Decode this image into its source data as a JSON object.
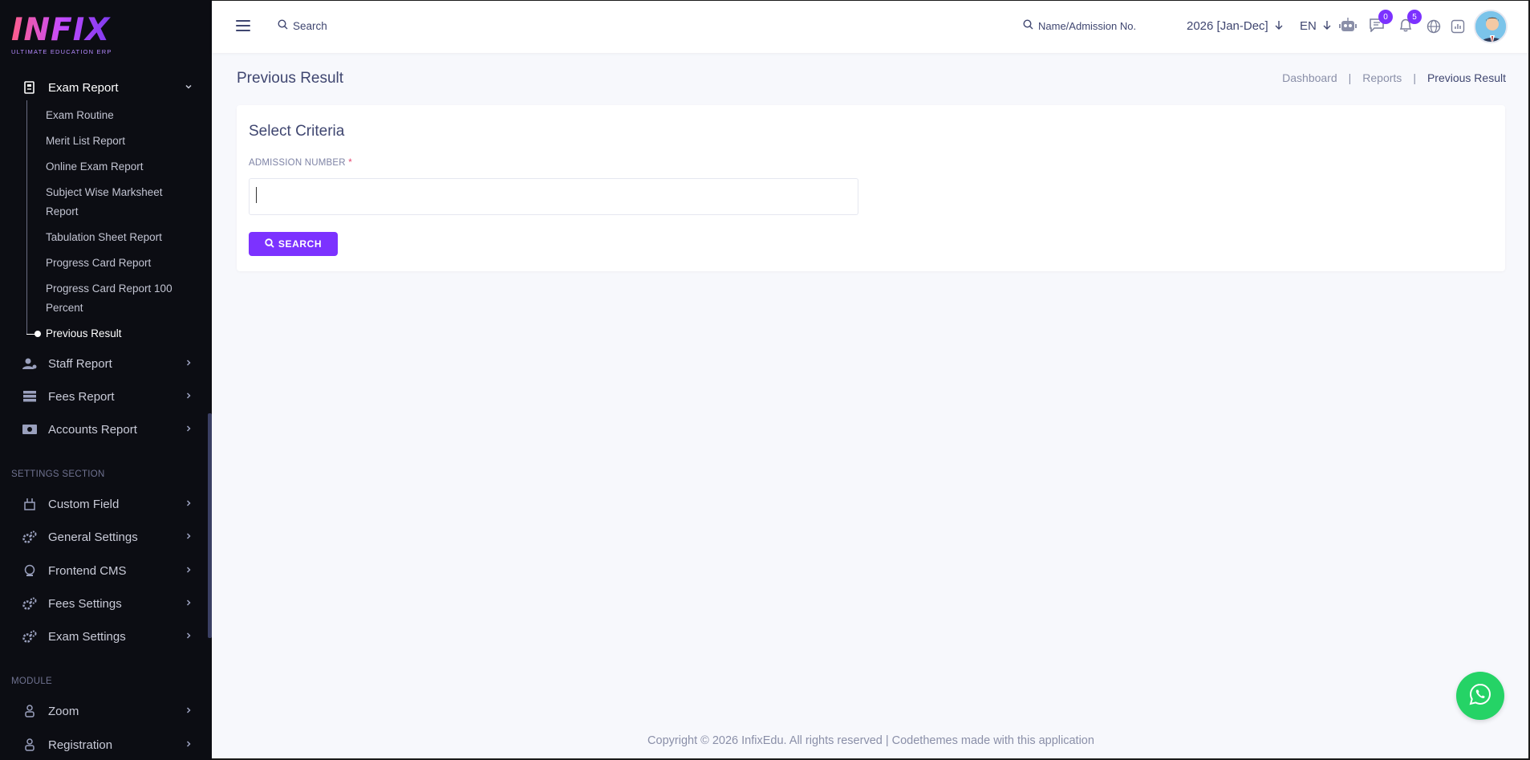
{
  "logo": {
    "title": "INFIX",
    "subtitle": "ULTIMATE EDUCATION ERP"
  },
  "sidebar": {
    "exam_report": {
      "label": "Exam Report",
      "icon": "document-icon"
    },
    "sub_items": [
      "Exam Routine",
      "Merit List Report",
      "Online Exam Report",
      "Subject Wise Marksheet",
      "Report",
      "Tabulation Sheet Report",
      "Progress Card Report",
      "Progress Card Report 100",
      "Percent",
      "Previous Result"
    ],
    "reports": [
      {
        "label": "Staff Report",
        "icon": "user-icon"
      },
      {
        "label": "Fees Report",
        "icon": "stack-icon"
      },
      {
        "label": "Accounts Report",
        "icon": "money-icon"
      }
    ],
    "settings_section": "SETTINGS SECTION",
    "settings": [
      {
        "label": "Custom Field",
        "icon": "form-icon"
      },
      {
        "label": "General Settings",
        "icon": "gears-icon"
      },
      {
        "label": "Frontend CMS",
        "icon": "cms-icon"
      },
      {
        "label": "Fees Settings",
        "icon": "gears-icon"
      },
      {
        "label": "Exam Settings",
        "icon": "gears-icon"
      }
    ],
    "module_section": "MODULE",
    "modules": [
      {
        "label": "Zoom",
        "icon": "person-icon"
      },
      {
        "label": "Registration",
        "icon": "person-icon"
      }
    ]
  },
  "topbar": {
    "search_label": "Search",
    "student_search_label": "Name/Admission No.",
    "session": "2026 [Jan-Dec]",
    "language": "EN",
    "messages_count": "0",
    "notifications_count": "5"
  },
  "page": {
    "title": "Previous Result",
    "breadcrumb": [
      "Dashboard",
      "Reports",
      "Previous Result"
    ],
    "separator": "|"
  },
  "criteria": {
    "title": "Select Criteria",
    "field_label": "ADMISSION NUMBER",
    "required_mark": "*",
    "input_value": "",
    "button_label": "SEARCH"
  },
  "footer": {
    "text": "Copyright © 2026 InfixEdu. All rights reserved | Codethemes made with this application"
  },
  "colors": {
    "accent": "#7c32ff",
    "sidebar_bg": "#0c0d13",
    "whatsapp": "#25d366"
  }
}
